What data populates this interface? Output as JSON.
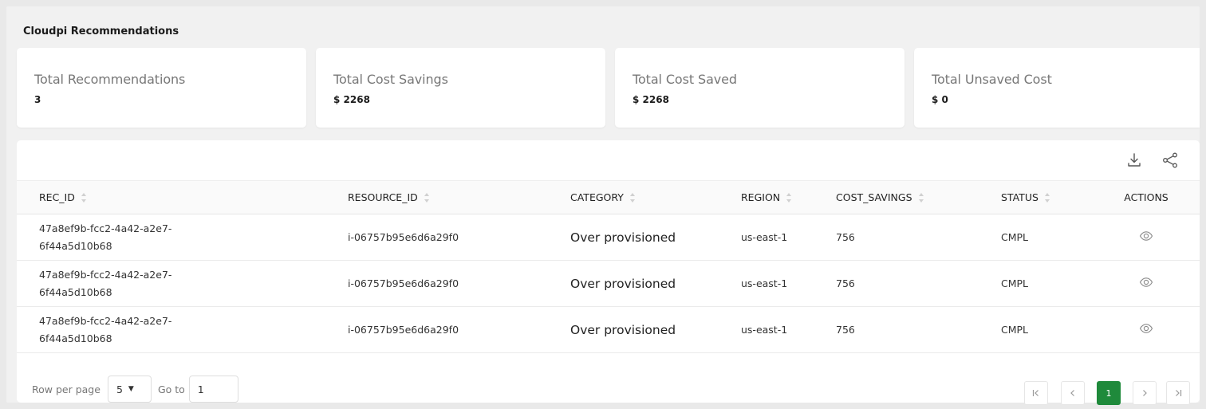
{
  "section": {
    "title": "Cloudpi Recommendations"
  },
  "cards": [
    {
      "label": "Total Recommendations",
      "value": "3"
    },
    {
      "label": "Total Cost Savings",
      "value": "$ 2268"
    },
    {
      "label": "Total Cost Saved",
      "value": "$ 2268"
    },
    {
      "label": "Total Unsaved Cost",
      "value": "$ 0"
    }
  ],
  "toolbar": {
    "download_icon": "download-icon",
    "share_icon": "share-icon"
  },
  "table": {
    "columns": [
      "REC_ID",
      "RESOURCE_ID",
      "CATEGORY",
      "REGION",
      "COST_SAVINGS",
      "STATUS",
      "ACTIONS"
    ],
    "rows": [
      {
        "rec_id_line1": "47a8ef9b-fcc2-4a42-a2e7-",
        "rec_id_line2": "6f44a5d10b68",
        "resource_id": "i-06757b95e6d6a29f0",
        "category": "Over provisioned",
        "region": "us-east-1",
        "cost_savings": "756",
        "status": "CMPL"
      },
      {
        "rec_id_line1": "47a8ef9b-fcc2-4a42-a2e7-",
        "rec_id_line2": "6f44a5d10b68",
        "resource_id": "i-06757b95e6d6a29f0",
        "category": "Over provisioned",
        "region": "us-east-1",
        "cost_savings": "756",
        "status": "CMPL"
      },
      {
        "rec_id_line1": "47a8ef9b-fcc2-4a42-a2e7-",
        "rec_id_line2": "6f44a5d10b68",
        "resource_id": "i-06757b95e6d6a29f0",
        "category": "Over provisioned",
        "region": "us-east-1",
        "cost_savings": "756",
        "status": "CMPL"
      }
    ]
  },
  "footer": {
    "rows_per_page_label": "Row per page",
    "rows_per_page_value": "5",
    "goto_label": "Go to",
    "goto_value": "1",
    "current_page": "1"
  },
  "colors": {
    "accent": "#1f8a3b"
  }
}
